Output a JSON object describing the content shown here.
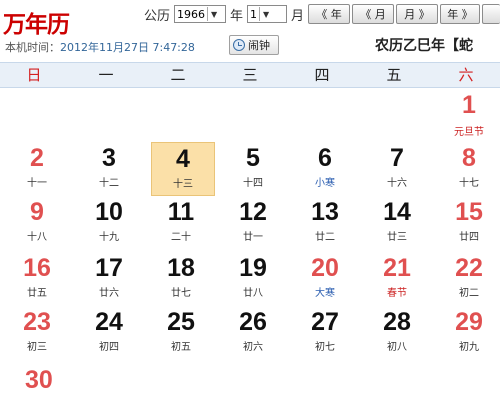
{
  "app": {
    "title": "万年历"
  },
  "controls": {
    "gongli_label": "公历",
    "year_value": "1966",
    "year_label": "年",
    "month_value": "1",
    "month_label": "月",
    "prev_year_btn": "《 年",
    "prev_month_btn": "《 月",
    "next_month_btn": "月 》",
    "next_year_btn": "年 》"
  },
  "clock": {
    "label": "本机时间：",
    "time": "2012年11月27日 7:47:28"
  },
  "alarm_button": "闹钟",
  "lunar_title": "农历乙巳年【蛇",
  "weekdays": [
    "日",
    "一",
    "二",
    "三",
    "四",
    "五",
    "六"
  ],
  "days": [
    {
      "day": "1",
      "sub": "元旦节",
      "col": 6,
      "row": 0,
      "num_style": "red",
      "sub_style": "red"
    },
    {
      "day": "2",
      "sub": "十一",
      "col": 0,
      "row": 1,
      "num_style": "red",
      "sub_style": ""
    },
    {
      "day": "3",
      "sub": "十二",
      "col": 1,
      "row": 1,
      "num_style": "",
      "sub_style": ""
    },
    {
      "day": "4",
      "sub": "十三",
      "col": 2,
      "row": 1,
      "num_style": "",
      "sub_style": "",
      "highlight": true
    },
    {
      "day": "5",
      "sub": "十四",
      "col": 3,
      "row": 1,
      "num_style": "",
      "sub_style": ""
    },
    {
      "day": "6",
      "sub": "小寒",
      "col": 4,
      "row": 1,
      "num_style": "",
      "sub_style": "blue"
    },
    {
      "day": "7",
      "sub": "十六",
      "col": 5,
      "row": 1,
      "num_style": "",
      "sub_style": ""
    },
    {
      "day": "8",
      "sub": "十七",
      "col": 6,
      "row": 1,
      "num_style": "red",
      "sub_style": ""
    },
    {
      "day": "9",
      "sub": "十八",
      "col": 0,
      "row": 2,
      "num_style": "red",
      "sub_style": ""
    },
    {
      "day": "10",
      "sub": "十九",
      "col": 1,
      "row": 2,
      "num_style": "",
      "sub_style": ""
    },
    {
      "day": "11",
      "sub": "二十",
      "col": 2,
      "row": 2,
      "num_style": "",
      "sub_style": ""
    },
    {
      "day": "12",
      "sub": "廿一",
      "col": 3,
      "row": 2,
      "num_style": "",
      "sub_style": ""
    },
    {
      "day": "13",
      "sub": "廿二",
      "col": 4,
      "row": 2,
      "num_style": "",
      "sub_style": ""
    },
    {
      "day": "14",
      "sub": "廿三",
      "col": 5,
      "row": 2,
      "num_style": "",
      "sub_style": ""
    },
    {
      "day": "15",
      "sub": "廿四",
      "col": 6,
      "row": 2,
      "num_style": "red",
      "sub_style": ""
    },
    {
      "day": "16",
      "sub": "廿五",
      "col": 0,
      "row": 3,
      "num_style": "red",
      "sub_style": ""
    },
    {
      "day": "17",
      "sub": "廿六",
      "col": 1,
      "row": 3,
      "num_style": "",
      "sub_style": ""
    },
    {
      "day": "18",
      "sub": "廿七",
      "col": 2,
      "row": 3,
      "num_style": "",
      "sub_style": ""
    },
    {
      "day": "19",
      "sub": "廿八",
      "col": 3,
      "row": 3,
      "num_style": "",
      "sub_style": ""
    },
    {
      "day": "20",
      "sub": "大寒",
      "col": 4,
      "row": 3,
      "num_style": "red",
      "sub_style": "blue"
    },
    {
      "day": "21",
      "sub": "春节",
      "col": 5,
      "row": 3,
      "num_style": "red",
      "sub_style": "red"
    },
    {
      "day": "22",
      "sub": "初二",
      "col": 6,
      "row": 3,
      "num_style": "red",
      "sub_style": ""
    },
    {
      "day": "23",
      "sub": "初三",
      "col": 0,
      "row": 4,
      "num_style": "red",
      "sub_style": ""
    },
    {
      "day": "24",
      "sub": "初四",
      "col": 1,
      "row": 4,
      "num_style": "",
      "sub_style": ""
    },
    {
      "day": "25",
      "sub": "初五",
      "col": 2,
      "row": 4,
      "num_style": "",
      "sub_style": ""
    },
    {
      "day": "26",
      "sub": "初六",
      "col": 3,
      "row": 4,
      "num_style": "",
      "sub_style": ""
    },
    {
      "day": "27",
      "sub": "初七",
      "col": 4,
      "row": 4,
      "num_style": "",
      "sub_style": ""
    },
    {
      "day": "28",
      "sub": "初八",
      "col": 5,
      "row": 4,
      "num_style": "",
      "sub_style": ""
    },
    {
      "day": "29",
      "sub": "初九",
      "col": 6,
      "row": 4,
      "num_style": "red",
      "sub_style": ""
    }
  ],
  "next_row_partial": "30"
}
